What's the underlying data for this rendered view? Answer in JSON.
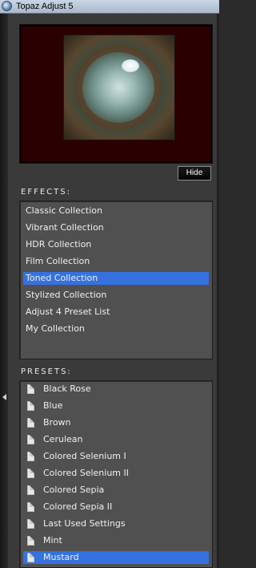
{
  "window": {
    "title": "Topaz Adjust 5"
  },
  "preview": {
    "hide_label": "Hide"
  },
  "effects": {
    "label": "EFFECTS:",
    "items": [
      "Classic Collection",
      "Vibrant Collection",
      "HDR Collection",
      "Film Collection",
      "Toned Collection",
      "Stylized Collection",
      "Adjust 4 Preset List",
      "My Collection"
    ],
    "selected": "Toned Collection"
  },
  "presets": {
    "label": "PRESETS:",
    "items": [
      "Black Rose",
      "Blue",
      "Brown",
      "Cerulean",
      "Colored Selenium I",
      "Colored Selenium II",
      "Colored Sepia",
      "Colored Sepia II",
      "Last Used Settings",
      "Mint",
      "Mustard"
    ],
    "selected": "Mustard"
  },
  "colors": {
    "selection": "#3572e0",
    "panel": "#3a3a3a",
    "list_bg": "#505050"
  }
}
